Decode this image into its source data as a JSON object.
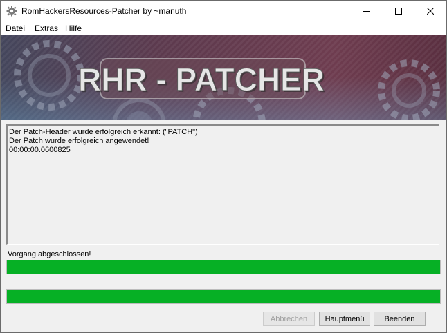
{
  "window": {
    "title": "RomHackersResources-Patcher by ~manuth",
    "icons": {
      "app": "gear-icon",
      "minimize": "minimize-icon",
      "maximize": "maximize-icon",
      "close": "close-icon"
    }
  },
  "menu": {
    "items": [
      {
        "accel": "D",
        "rest": "atei"
      },
      {
        "accel": "E",
        "rest": "xtras"
      },
      {
        "accel": "H",
        "rest": "ilfe"
      }
    ]
  },
  "banner": {
    "logo_text": "RHR - PATCHER",
    "colors": {
      "dark": "#3f2a3a",
      "mid": "#6f3e50",
      "accent": "#e8e8e8"
    }
  },
  "log": {
    "lines": [
      "Der Patch-Header wurde erfolgreich erkannt: (\"PATCH\")",
      "Der Patch wurde erfolgreich angewendet!",
      "00:00:00.0600825"
    ]
  },
  "status": {
    "label": "Vorgang abgeschlossen!",
    "progress_bars": [
      1.0,
      1.0
    ],
    "progress_color": "#06b025"
  },
  "buttons": {
    "abort": "Abbrechen",
    "main_menu": "Hauptmenü",
    "exit": "Beenden"
  }
}
